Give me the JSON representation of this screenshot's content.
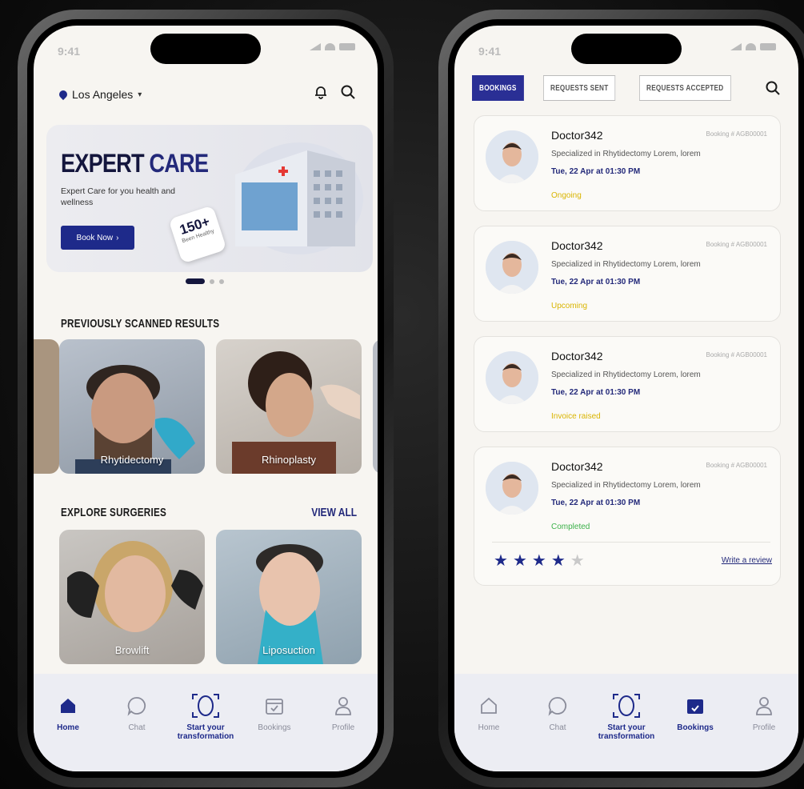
{
  "status": {
    "time": "9:41"
  },
  "left": {
    "location": "Los Angeles",
    "banner": {
      "title_part1": "EXPERT",
      "title_part2": "CARE",
      "subtitle": "Expert Care for you health and wellness",
      "button": "Book Now",
      "badge_number": "150+",
      "badge_text": "Been Healthy"
    },
    "scanned_title": "PREVIOUSLY SCANNED RESULTS",
    "scanned": [
      {
        "label": "Rhytidectomy"
      },
      {
        "label": "Rhinoplasty"
      }
    ],
    "explore_title": "EXPLORE SURGERIES",
    "view_all": "VIEW ALL",
    "surgeries": [
      {
        "label": "Browlift"
      },
      {
        "label": "Liposuction"
      }
    ],
    "tabs": [
      {
        "label": "Home",
        "icon": "home-icon",
        "active": true
      },
      {
        "label": "Chat",
        "icon": "chat-icon"
      },
      {
        "label": "Start your transformation",
        "icon": "face-scan-icon"
      },
      {
        "label": "Bookings",
        "icon": "calendar-icon"
      },
      {
        "label": "Profile",
        "icon": "user-icon"
      }
    ]
  },
  "right": {
    "tabs": [
      {
        "label": "BOOKINGS",
        "active": true
      },
      {
        "label": "REQUESTS SENT"
      },
      {
        "label": "REQUESTS ACCEPTED"
      }
    ],
    "bookings": [
      {
        "name": "Doctor342",
        "booking_no": "Booking # AGB00001",
        "spec": "Specialized in Rhytidectomy Lorem, lorem",
        "date": "Tue, 22 Apr at 01:30 PM",
        "status": "Ongoing",
        "status_color": "#d9b400"
      },
      {
        "name": "Doctor342",
        "booking_no": "Booking # AGB00001",
        "spec": "Specialized in Rhytidectomy Lorem, lorem",
        "date": "Tue, 22 Apr at 01:30 PM",
        "status": "Upcoming",
        "status_color": "#d9b400"
      },
      {
        "name": "Doctor342",
        "booking_no": "Booking # AGB00001",
        "spec": "Specialized in Rhytidectomy Lorem, lorem",
        "date": "Tue, 22 Apr at 01:30 PM",
        "status": "Invoice raised",
        "status_color": "#d9b400"
      },
      {
        "name": "Doctor342",
        "booking_no": "Booking # AGB00001",
        "spec": "Specialized in Rhytidectomy Lorem, lorem",
        "date": "Tue, 22 Apr at 01:30 PM",
        "status": "Completed",
        "status_color": "#3cb14a",
        "rating": 4,
        "rating_max": 5,
        "review_link": "Write a review"
      }
    ],
    "tab_bar": [
      {
        "label": "Home",
        "icon": "home-icon"
      },
      {
        "label": "Chat",
        "icon": "chat-icon"
      },
      {
        "label": "Start your transformation",
        "icon": "face-scan-icon"
      },
      {
        "label": "Bookings",
        "icon": "calendar-icon",
        "active": true
      },
      {
        "label": "Profile",
        "icon": "user-icon"
      }
    ]
  },
  "colors": {
    "brand": "#1e2a8a",
    "ongoing": "#d9b400",
    "completed": "#3cb14a"
  }
}
